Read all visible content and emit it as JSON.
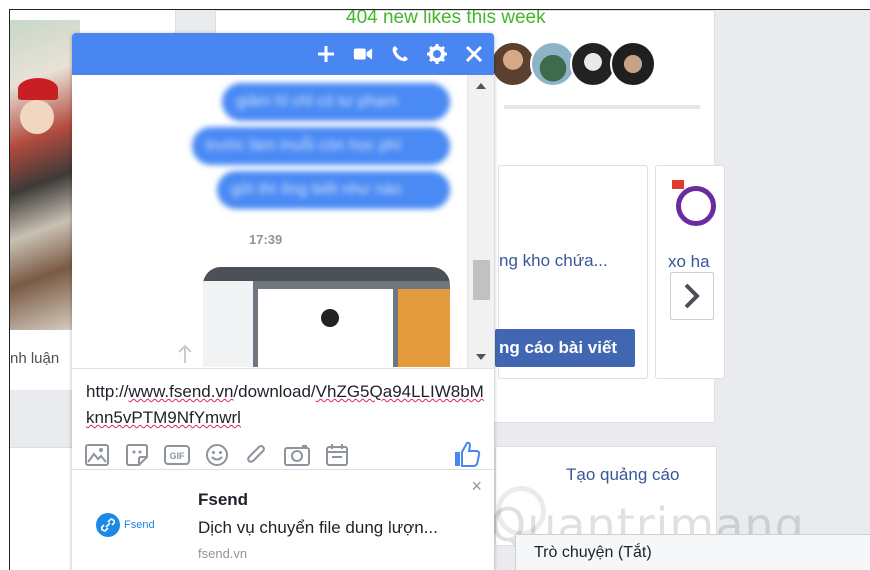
{
  "feed": {
    "likes_text": "404 new likes this week",
    "comment_label": "nh luận",
    "ad1_title": "ng kho chứa...",
    "ad1_button": "ng cáo bài viết",
    "ad2_title": "xo ha",
    "create_ad": "Tạo quảng cáo",
    "chat_bar": "Trò chuyện (Tắt)",
    "watermark": "Quantrimang"
  },
  "chat": {
    "header_icons": [
      "plus-icon",
      "video-icon",
      "phone-icon",
      "gear-icon",
      "close-icon"
    ],
    "messages": [
      "giảm hỉ chỉ có tư phạm",
      "trước làm muỗi còn học phí",
      "gởi thì ông biết như nào"
    ],
    "timestamp": "17:39",
    "composer_text_a": "http://",
    "composer_text_b": "www.fsend.vn",
    "composer_text_c": "/download/",
    "composer_text_d": "VhZG5Qa94LLIW8bMknn5vPTM9NfYmwrl",
    "toolbar_icons": [
      "image-icon",
      "sticker-icon",
      "gif-icon",
      "emoji-icon",
      "attachment-icon",
      "camera-icon",
      "calendar-icon"
    ],
    "link_preview": {
      "logo_text": "Fsend",
      "title": "Fsend",
      "description": "Dịch vụ chuyển file dung lượn...",
      "domain": "fsend.vn",
      "close": "×"
    }
  },
  "colors": {
    "messenger_blue": "#4a86f2",
    "facebook_blue": "#4267b2",
    "link_blue": "#365899",
    "green": "#42b72a"
  }
}
